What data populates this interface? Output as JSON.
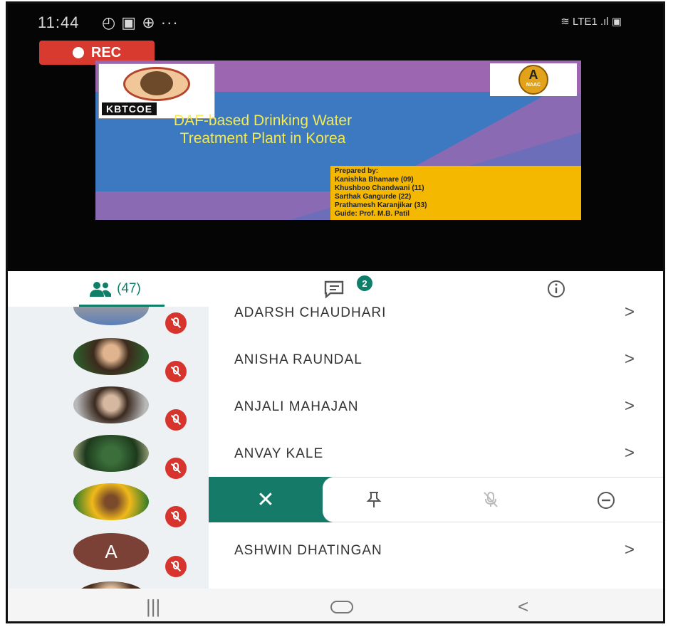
{
  "status_bar": {
    "time": "11:44",
    "icons_right": "LTE1"
  },
  "recording": {
    "label": "REC"
  },
  "slide": {
    "logo_text": "KBTCOE",
    "badge_letter": "A",
    "badge_text": "NAAC",
    "title": "DAF-based Drinking Water Treatment Plant in Korea",
    "prepared_by": [
      "Prepared by:",
      "Kanishka Bhamare (09)",
      "Khushboo Chandwani (11)",
      "Sarthak Gangurde (22)",
      "Prathamesh Karanjikar (33)",
      "Guide: Prof. M.B. Patil"
    ]
  },
  "tabs": {
    "people_count": "(47)",
    "chat_badge": "2"
  },
  "participants": [
    {
      "name": "ADARSH CHAUDHARI"
    },
    {
      "name": "ANISHA RAUNDAL"
    },
    {
      "name": "ANJALI MAHAJAN"
    },
    {
      "name": "ANVAY KALE"
    },
    {
      "name": ""
    },
    {
      "name": "ASHWIN DHATINGAN",
      "initial": "A"
    }
  ],
  "row_chevron": ">",
  "actions": {
    "close": "✕"
  },
  "colors": {
    "accent": "#107f6a",
    "mute_red": "#d6342c",
    "rec_red": "#d83a2f"
  }
}
